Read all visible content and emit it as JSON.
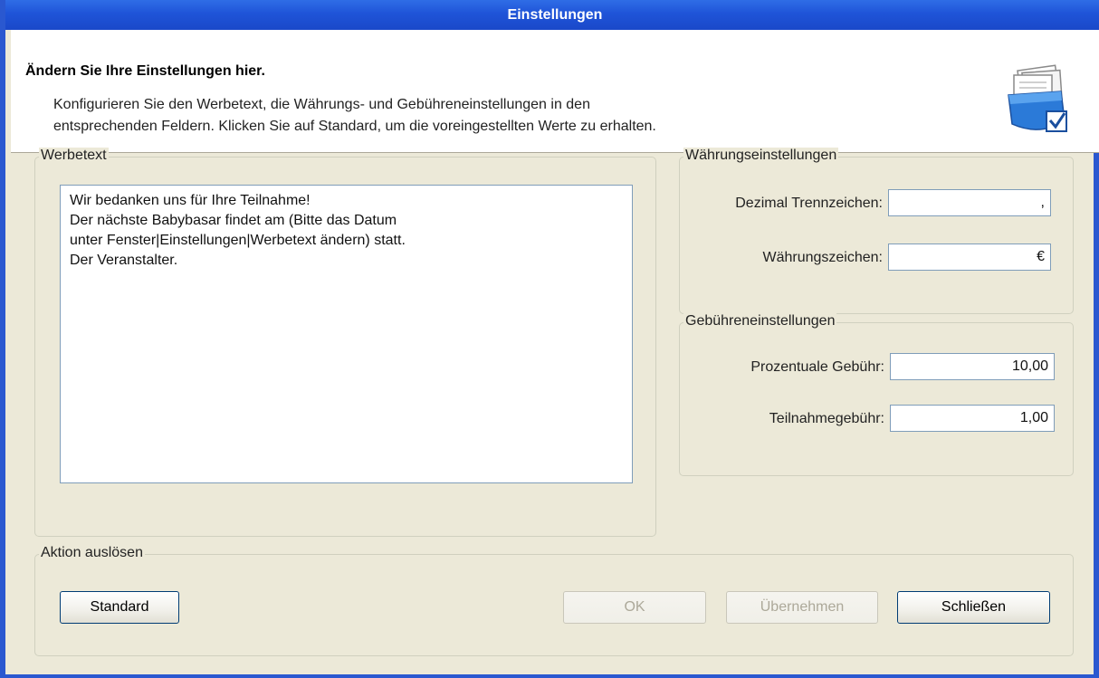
{
  "window": {
    "title": "Einstellungen"
  },
  "header": {
    "title": "Ändern Sie Ihre Einstellungen hier.",
    "description_line1": "Konfigurieren Sie den Werbetext, die Währungs- und Gebühreneinstellungen in den",
    "description_line2": "entsprechenden Feldern. Klicken Sie auf Standard, um die voreingestellten Werte zu erhalten.",
    "icon": "settings-folder-check-icon"
  },
  "werbetext": {
    "legend": "Werbetext",
    "text": "Wir bedanken uns für Ihre Teilnahme!\nDer nächste Babybasar findet am (Bitte das Datum\nunter Fenster|Einstellungen|Werbetext ändern) statt.\nDer Veranstalter."
  },
  "waehrung": {
    "legend": "Währungseinstellungen",
    "decimal_label": "Dezimal Trennzeichen:",
    "decimal_value": ",",
    "currency_label": "Währungszeichen:",
    "currency_value": "€"
  },
  "gebuehren": {
    "legend": "Gebühreneinstellungen",
    "percent_label": "Prozentuale Gebühr:",
    "percent_value": "10,00",
    "participation_label": "Teilnahmegebühr:",
    "participation_value": "1,00"
  },
  "aktion": {
    "legend": "Aktion auslösen",
    "standard_label": "Standard",
    "ok_label": "OK",
    "apply_label": "Übernehmen",
    "close_label": "Schließen"
  },
  "colors": {
    "titlebar": "#1f54d8",
    "window_bg": "#ece9d8",
    "button_border": "#003c74"
  }
}
